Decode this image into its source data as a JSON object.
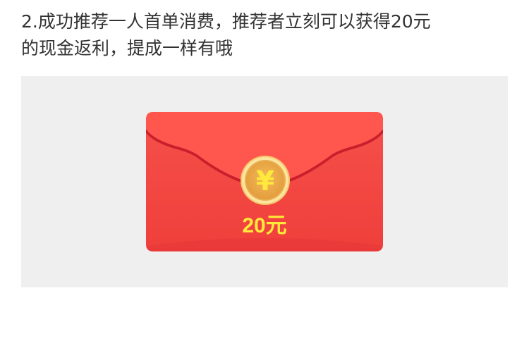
{
  "description": {
    "line1": "2.成功推荐一人首单消费，推荐者立刻可以获得20元",
    "line2": "的现金返利，提成一样有哦"
  },
  "red_packet": {
    "coin_symbol": "¥",
    "amount": "20元",
    "colors": {
      "envelope_body": "#f44a43",
      "envelope_flap": "#ff5a50",
      "coin_outer": "#f7d57a",
      "coin_inner": "#eaaa4a",
      "amount_text": "#ffe93a",
      "panel_bg": "#efefef"
    },
    "icon": "yuan-coin-icon"
  }
}
